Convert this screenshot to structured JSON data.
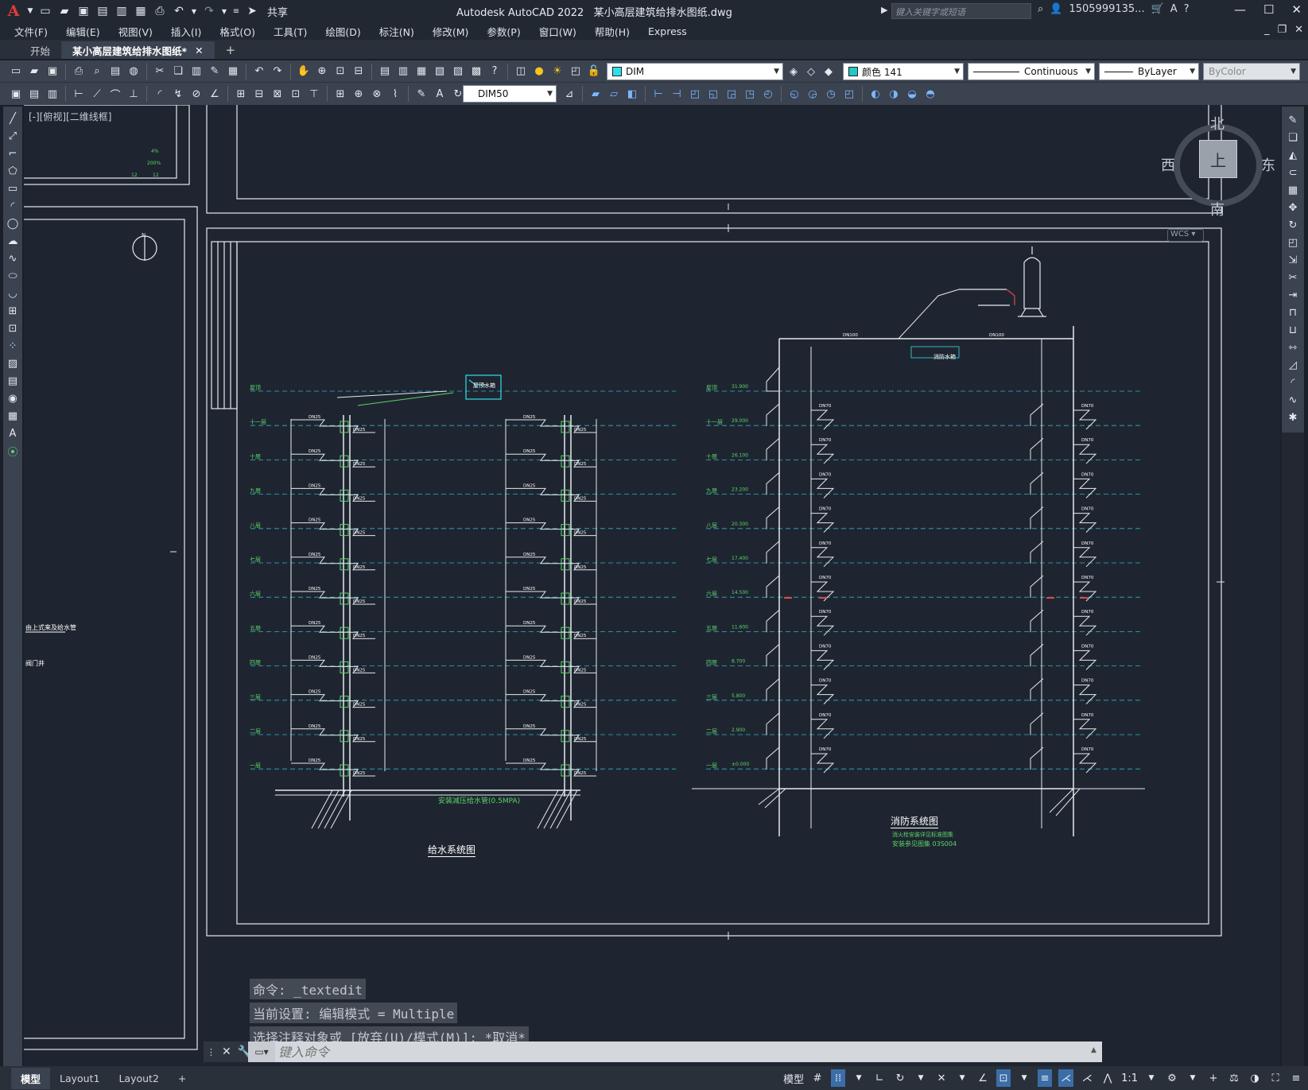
{
  "titlebar": {
    "app_name": "Autodesk AutoCAD 2022",
    "file_name": "某小高层建筑给排水图纸.dwg",
    "share_label": "共享",
    "search_placeholder": "键入关键字或短语",
    "user": "1505999135...",
    "logo_letter": "A"
  },
  "menu": [
    "文件(F)",
    "编辑(E)",
    "视图(V)",
    "插入(I)",
    "格式(O)",
    "工具(T)",
    "绘图(D)",
    "标注(N)",
    "修改(M)",
    "参数(P)",
    "窗口(W)",
    "帮助(H)",
    "Express"
  ],
  "tabs": {
    "start": "开始",
    "active_doc": "某小高层建筑给排水图纸*",
    "add": "+"
  },
  "properties": {
    "layer": "DIM",
    "color": "颜色 141",
    "linetype": "Continuous",
    "lineweight": "ByLayer",
    "plotstyle": "ByColor",
    "dimstyle": "DIM50",
    "layer_color": "#30e0e8",
    "color_swatch": "#22c7c7"
  },
  "canvas": {
    "viewport_label": "[-][俯视][二维线框]",
    "viewcube": {
      "north": "北",
      "south": "南",
      "east": "东",
      "west": "西",
      "top": "上"
    },
    "wcs": "WCS"
  },
  "drawing": {
    "left_title": "给水系统图",
    "right_title": "消防系统图",
    "note_pressure": "安装减压给水管(0.5MPA)",
    "note_fire_1": "消火栓安装详见标准图集",
    "note_fire_2": "安装参见图集 03S004",
    "floor_labels": [
      "屋顶",
      "十一层",
      "十层",
      "九层",
      "八层",
      "七层",
      "六层",
      "五层",
      "四层",
      "三层",
      "二层",
      "一层"
    ],
    "elevations": [
      "31.900",
      "29.000",
      "26.100",
      "23.200",
      "20.300",
      "17.400",
      "14.500",
      "11.600",
      "8.700",
      "5.800",
      "2.900",
      "±0.000"
    ],
    "tank_label_1": "屋顶水箱",
    "tank_label_2": "消防水箱",
    "pipe_left": "DN25",
    "pipe_main": "DN70",
    "pipe_top": "DN100",
    "side_note_1": "由上式来及给水管",
    "side_note_2": "阀门井"
  },
  "command": {
    "history": [
      "命令: _textedit",
      "当前设置: 编辑模式 = Multiple",
      "选择注释对象或 [放弃(U)/模式(M)]: *取消*"
    ],
    "input_placeholder": "键入命令"
  },
  "status": {
    "layouts": [
      "模型",
      "Layout1",
      "Layout2"
    ],
    "model_label": "模型",
    "scale": "1:1"
  }
}
